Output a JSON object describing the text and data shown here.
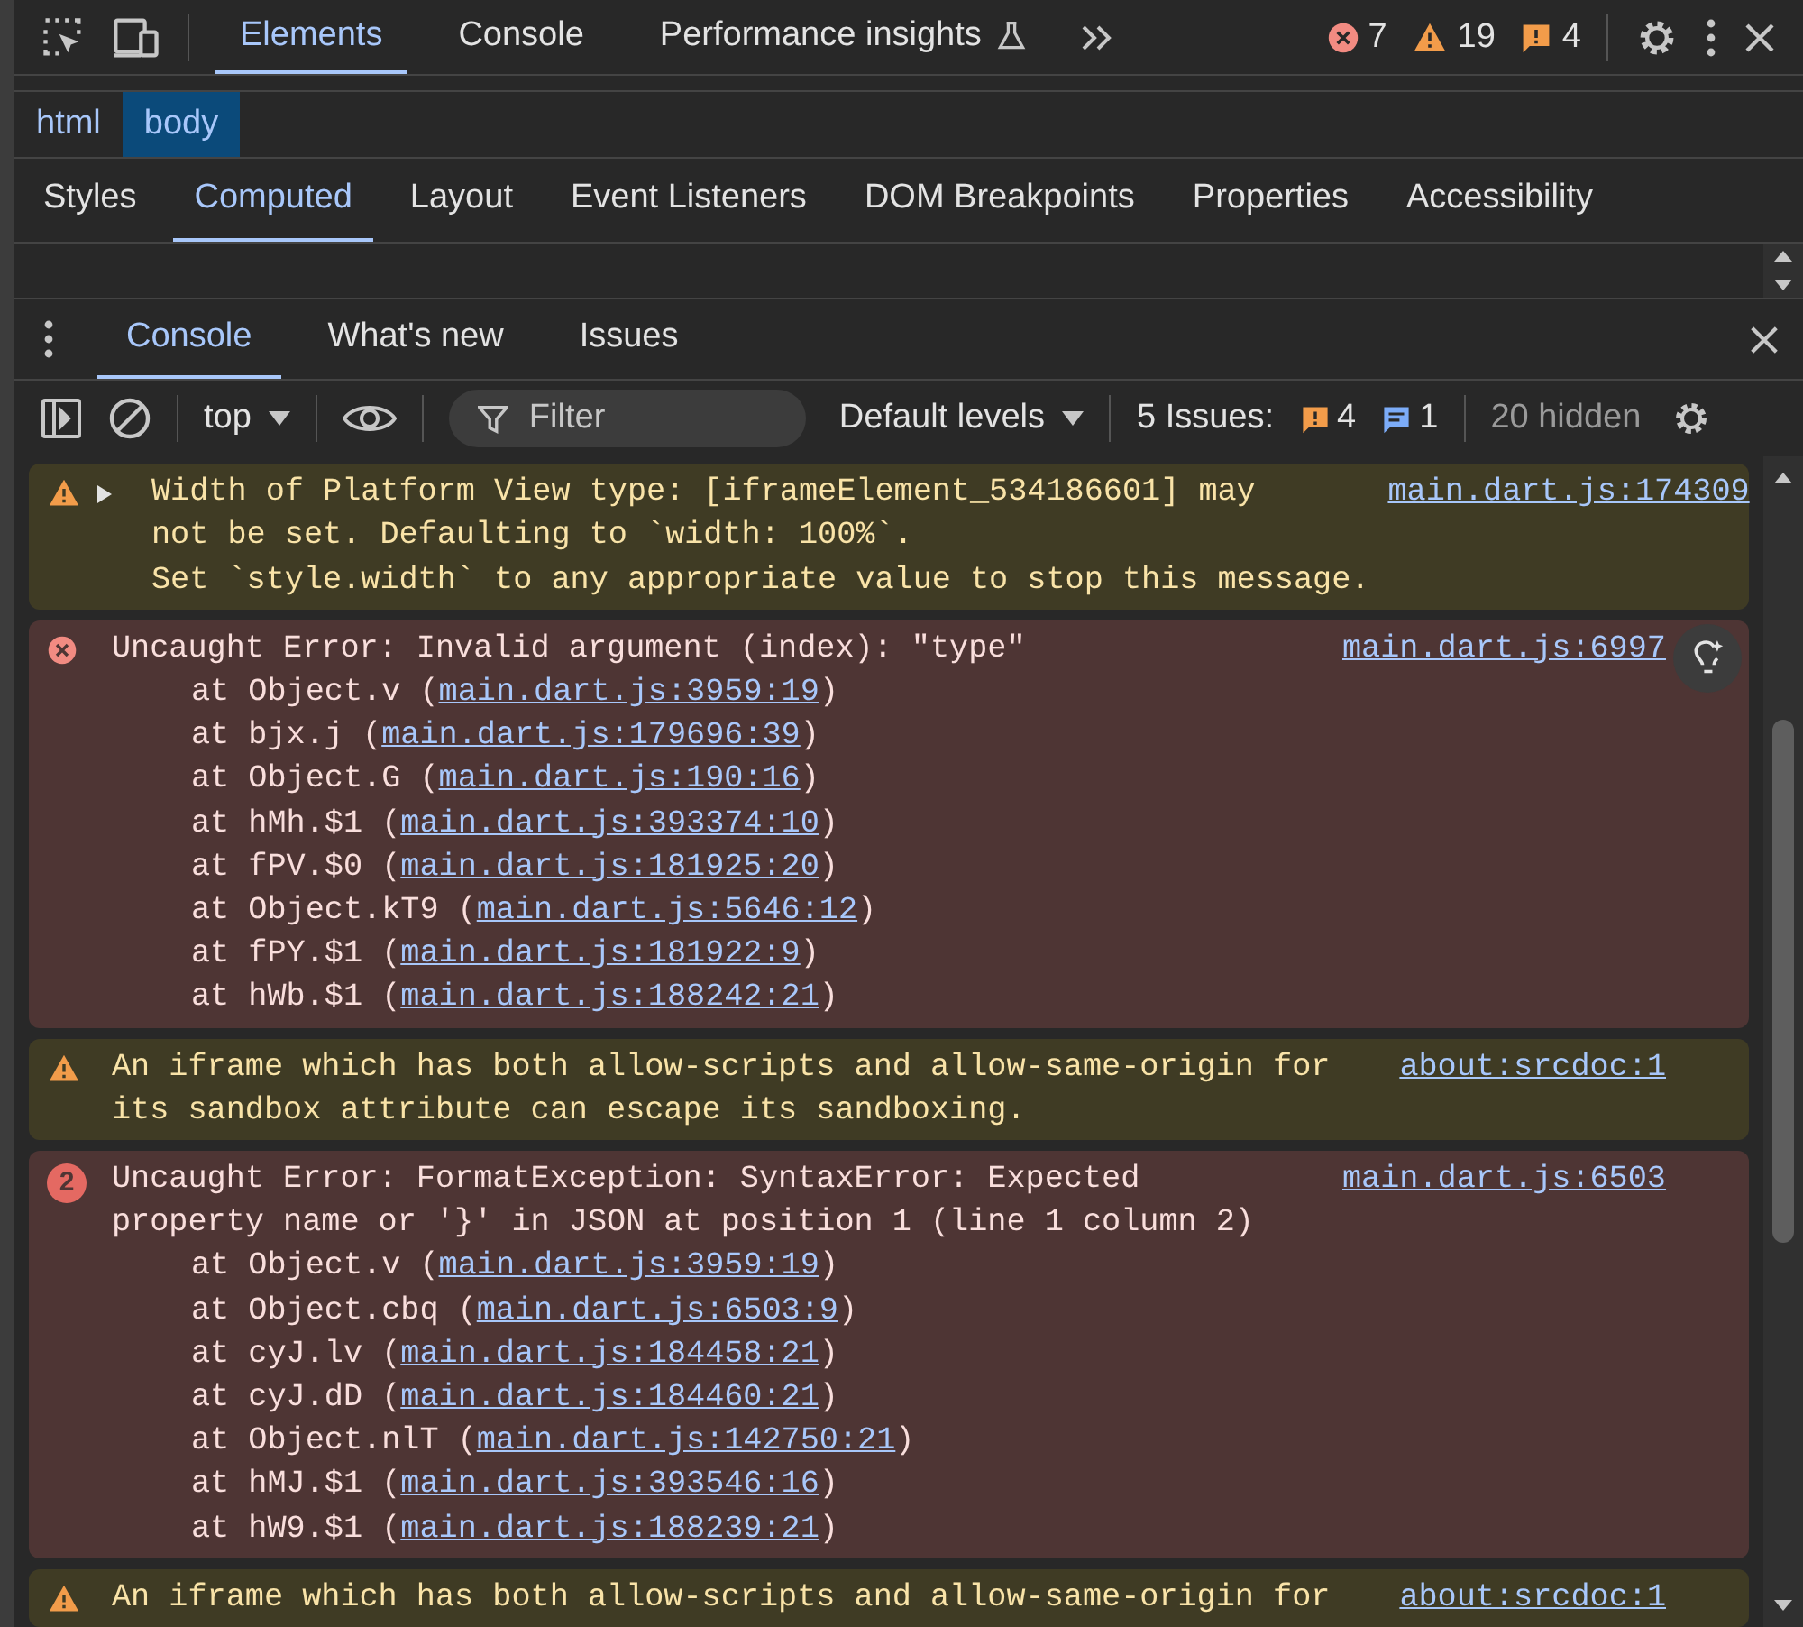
{
  "main_toolbar": {
    "tabs": [
      {
        "label": "Elements",
        "selected": true
      },
      {
        "label": "Console",
        "selected": false
      },
      {
        "label": "Performance insights",
        "selected": false
      }
    ],
    "counts": [
      {
        "kind": "error",
        "value": "7"
      },
      {
        "kind": "warning",
        "value": "19"
      },
      {
        "kind": "issue",
        "value": "4"
      }
    ]
  },
  "breadcrumbs": [
    {
      "label": "html",
      "selected": false
    },
    {
      "label": "body",
      "selected": true
    }
  ],
  "sidebar_tabs": [
    {
      "label": "Styles",
      "selected": false
    },
    {
      "label": "Computed",
      "selected": true
    },
    {
      "label": "Layout",
      "selected": false
    },
    {
      "label": "Event Listeners",
      "selected": false
    },
    {
      "label": "DOM Breakpoints",
      "selected": false
    },
    {
      "label": "Properties",
      "selected": false
    },
    {
      "label": "Accessibility",
      "selected": false
    }
  ],
  "drawer_tabs": [
    {
      "label": "Console",
      "selected": true
    },
    {
      "label": "What's new",
      "selected": false
    },
    {
      "label": "Issues",
      "selected": false
    }
  ],
  "console_toolbar": {
    "context": "top",
    "filter_placeholder": "Filter",
    "levels": "Default levels",
    "issues_label": "5 Issues:",
    "issue_counts": [
      {
        "kind": "issue",
        "value": "4"
      },
      {
        "kind": "info",
        "value": "1"
      }
    ],
    "hidden": "20 hidden"
  },
  "messages": [
    {
      "kind": "warning",
      "expanded": false,
      "lines": [
        "Width of Platform View type: [iframeElement_534186601] may",
        "not be set. Defaulting to `width: 100%`.",
        "Set `style.width` to any appropriate value to stop this message."
      ],
      "source": "main.dart.js:174309"
    },
    {
      "kind": "error",
      "lines": [
        "Uncaught Error: Invalid argument (index): \"type\""
      ],
      "source": "main.dart.js:6997",
      "insight": true,
      "frames": [
        {
          "prefix": "at Object.v (",
          "link": "main.dart.js:3959:19",
          "suffix": ")"
        },
        {
          "prefix": "at bjx.j (",
          "link": "main.dart.js:179696:39",
          "suffix": ")"
        },
        {
          "prefix": "at Object.G (",
          "link": "main.dart.js:190:16",
          "suffix": ")"
        },
        {
          "prefix": "at hMh.$1 (",
          "link": "main.dart.js:393374:10",
          "suffix": ")"
        },
        {
          "prefix": "at fPV.$0 (",
          "link": "main.dart.js:181925:20",
          "suffix": ")"
        },
        {
          "prefix": "at Object.kT9 (",
          "link": "main.dart.js:5646:12",
          "suffix": ")"
        },
        {
          "prefix": "at fPY.$1 (",
          "link": "main.dart.js:181922:9",
          "suffix": ")"
        },
        {
          "prefix": "at hWb.$1 (",
          "link": "main.dart.js:188242:21",
          "suffix": ")"
        }
      ]
    },
    {
      "kind": "warning",
      "lines": [
        "An iframe which has both allow-scripts and allow-same-origin for",
        "its sandbox attribute can escape its sandboxing."
      ],
      "source": "about:srcdoc:1"
    },
    {
      "kind": "error",
      "repeat": "2",
      "lines": [
        "Uncaught Error: FormatException: SyntaxError: Expected",
        "property name or '}' in JSON at position 1 (line 1 column 2)"
      ],
      "source": "main.dart.js:6503",
      "frames": [
        {
          "prefix": "at Object.v (",
          "link": "main.dart.js:3959:19",
          "suffix": ")"
        },
        {
          "prefix": "at Object.cbq (",
          "link": "main.dart.js:6503:9",
          "suffix": ")"
        },
        {
          "prefix": "at cyJ.lv (",
          "link": "main.dart.js:184458:21",
          "suffix": ")"
        },
        {
          "prefix": "at cyJ.dD (",
          "link": "main.dart.js:184460:21",
          "suffix": ")"
        },
        {
          "prefix": "at Object.nlT (",
          "link": "main.dart.js:142750:21",
          "suffix": ")"
        },
        {
          "prefix": "at hMJ.$1 (",
          "link": "main.dart.js:393546:16",
          "suffix": ")"
        },
        {
          "prefix": "at hW9.$1 (",
          "link": "main.dart.js:188239:21",
          "suffix": ")"
        }
      ]
    },
    {
      "kind": "warning",
      "lines": [
        "An iframe which has both allow-scripts and allow-same-origin for"
      ],
      "source": "about:srcdoc:1"
    }
  ]
}
